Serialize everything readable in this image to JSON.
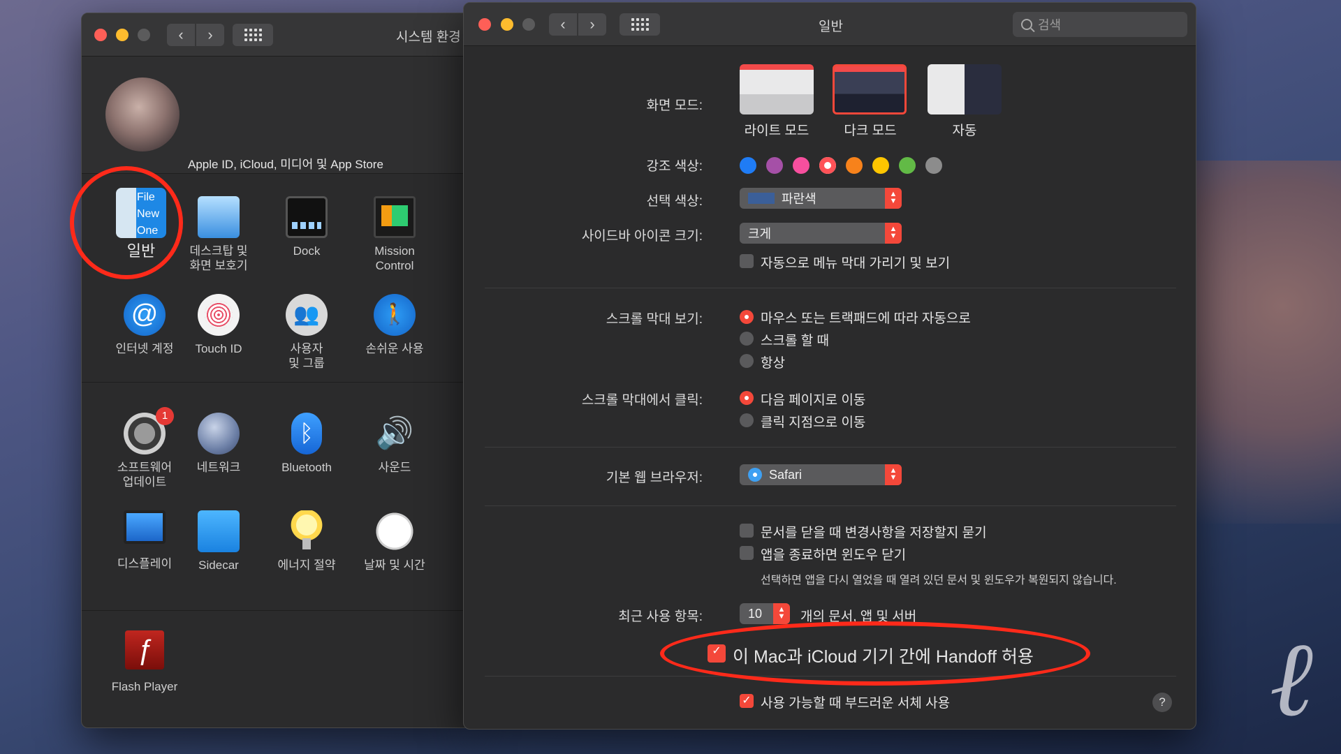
{
  "left_window": {
    "title": "시스템 환경",
    "account_label": "Apple ID, iCloud, 미디어 및 App Store",
    "panes_row1": [
      {
        "label": "일반",
        "icon": "general-icon"
      },
      {
        "label": "데스크탑 및\n화면 보호기",
        "icon": "desktop-icon"
      },
      {
        "label": "Dock",
        "icon": "dock-icon"
      },
      {
        "label": "Mission\nControl",
        "icon": "mission-control-icon"
      }
    ],
    "panes_row2": [
      {
        "label": "인터넷 계정",
        "icon": "internet-accounts-icon"
      },
      {
        "label": "Touch ID",
        "icon": "touch-id-icon"
      },
      {
        "label": "사용자\n및 그룹",
        "icon": "users-icon"
      },
      {
        "label": "손쉬운 사용",
        "icon": "accessibility-icon"
      }
    ],
    "panes_row3": [
      {
        "label": "소프트웨어\n업데이트",
        "icon": "software-update-icon",
        "badge": "1"
      },
      {
        "label": "네트워크",
        "icon": "network-icon"
      },
      {
        "label": "Bluetooth",
        "icon": "bluetooth-icon"
      },
      {
        "label": "사운드",
        "icon": "sound-icon"
      }
    ],
    "panes_row4": [
      {
        "label": "디스플레이",
        "icon": "display-icon"
      },
      {
        "label": "Sidecar",
        "icon": "sidecar-icon"
      },
      {
        "label": "에너지 절약",
        "icon": "energy-icon"
      },
      {
        "label": "날짜 및 시간",
        "icon": "clock-icon"
      }
    ],
    "panes_row5": [
      {
        "label": "Flash Player",
        "icon": "flash-icon"
      }
    ]
  },
  "right_window": {
    "title": "일반",
    "search_placeholder": "검색",
    "appearance": {
      "label": "화면 모드:",
      "options": [
        "라이트 모드",
        "다크 모드",
        "자동"
      ],
      "selected": "다크 모드"
    },
    "accent": {
      "label": "강조 색상:",
      "colors": [
        "#1f7cf5",
        "#a550a7",
        "#f74f9e",
        "#ff5257",
        "#f7821b",
        "#ffc600",
        "#62ba46",
        "#8c8c8c"
      ],
      "selected_index": 3
    },
    "highlight": {
      "label": "선택 색상:",
      "value": "파란색"
    },
    "sidebar_icon_size": {
      "label": "사이드바 아이콘 크기:",
      "value": "크게"
    },
    "auto_hide_menu": {
      "label": "자동으로 메뉴 막대 가리기 및 보기",
      "checked": false
    },
    "show_scrollbars": {
      "label": "스크롤 막대 보기:",
      "options": [
        "마우스 또는 트랙패드에 따라 자동으로",
        "스크롤 할 때",
        "항상"
      ],
      "selected_index": 0
    },
    "click_scrollbar": {
      "label": "스크롤 막대에서 클릭:",
      "options": [
        "다음 페이지로 이동",
        "클릭 지점으로 이동"
      ],
      "selected_index": 0
    },
    "browser": {
      "label": "기본 웹 브라우저:",
      "value": "Safari"
    },
    "ask_keep_changes": {
      "label": "문서를 닫을 때 변경사항을 저장할지 묻기",
      "checked": false
    },
    "close_windows": {
      "label": "앱을 종료하면 윈도우 닫기",
      "checked": false
    },
    "close_windows_note": "선택하면 앱을 다시 열었을 때 열려 있던 문서 및 윈도우가 복원되지 않습니다.",
    "recent_items": {
      "label": "최근 사용 항목:",
      "value": "10",
      "suffix": "개의 문서, 앱 및 서버"
    },
    "handoff": {
      "label": "이 Mac과 iCloud 기기 간에 Handoff 허용",
      "checked": true
    },
    "font_smoothing": {
      "label": "사용 가능할 때 부드러운 서체 사용",
      "checked": true
    },
    "help": "?"
  },
  "colors": {
    "window_bg": "#2b2b2c",
    "accent_red": "#f4483a",
    "annotation_red": "#ff2a1a"
  }
}
